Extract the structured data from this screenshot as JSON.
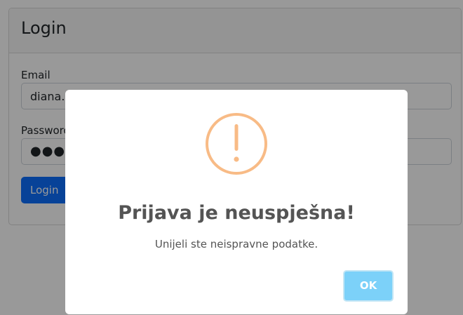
{
  "card": {
    "title": "Login",
    "email_label": "Email",
    "email_value": "diana.v",
    "password_label": "Password",
    "password_value": "●●●●●",
    "login_button": "Login"
  },
  "modal": {
    "icon": "exclamation-circle-icon",
    "title": "Prijava je neuspješna!",
    "text": "Unijeli ste neispravne podatke.",
    "ok_button": "OK"
  },
  "colors": {
    "primary": "#0d6efd",
    "warning_icon": "#f8bb86",
    "ok_button": "#7cd1f9",
    "text": "#545454"
  }
}
